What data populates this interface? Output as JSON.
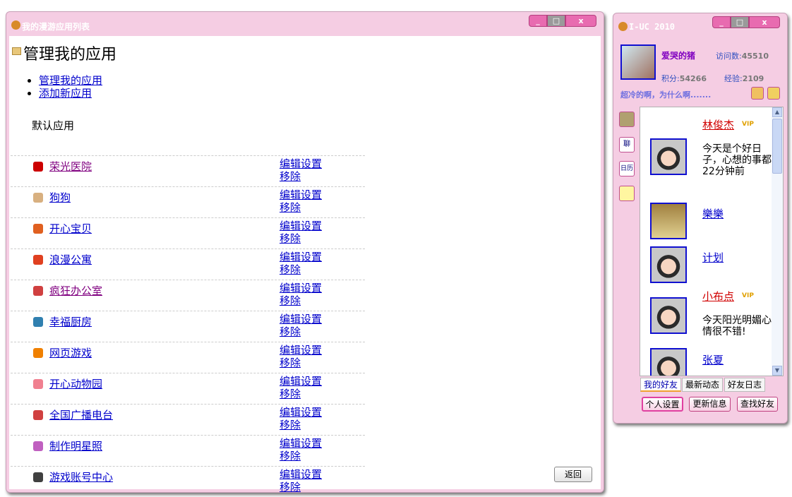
{
  "main_window": {
    "title": "我的漫游应用列表",
    "heading": "管理我的应用",
    "nav": [
      "管理我的应用",
      "添加新应用"
    ],
    "section": "默认应用",
    "apps": [
      {
        "name": "荣光医院",
        "icon": "red-cross-icon",
        "color": "#cc0000",
        "visited": true
      },
      {
        "name": "狗狗",
        "icon": "dog-icon",
        "color": "#d8b080",
        "visited": false
      },
      {
        "name": "开心宝贝",
        "icon": "baby-icon",
        "color": "#e06020",
        "visited": false
      },
      {
        "name": "浪漫公寓",
        "icon": "house-icon",
        "color": "#e04020",
        "visited": false
      },
      {
        "name": "疯狂办公室",
        "icon": "office-icon",
        "color": "#d04040",
        "visited": true
      },
      {
        "name": "幸福厨房",
        "icon": "kitchen-icon",
        "color": "#3080b0",
        "visited": false
      },
      {
        "name": "网页游戏",
        "icon": "game-icon",
        "color": "#f08000",
        "visited": false
      },
      {
        "name": "开心动物园",
        "icon": "pig-icon",
        "color": "#f08090",
        "visited": false
      },
      {
        "name": "全国广播电台",
        "icon": "radio-icon",
        "color": "#d04040",
        "visited": false
      },
      {
        "name": "制作明星照",
        "icon": "star-photo-icon",
        "color": "#c060c0",
        "visited": false
      },
      {
        "name": "游戏账号中心",
        "icon": "account-icon",
        "color": "#404040",
        "visited": false
      }
    ],
    "edit_label": "编辑设置",
    "remove_label": "移除",
    "back_label": "返回"
  },
  "side_window": {
    "title": "I-UC 2010",
    "username": "爱哭的猪",
    "visits_label": "访问数:",
    "visits": "45510",
    "points_label": "积分:",
    "points": "54266",
    "exp_label": "经验:",
    "exp": "2109",
    "status": "超冷的啊，为什么啊.......",
    "side_icons": [
      "photo-icon",
      "chat-icon",
      "calendar-icon",
      "weather-icon"
    ],
    "chat_label": "聊",
    "calendar_label": "日历",
    "friends": [
      {
        "name": "林俊杰",
        "vip": "VIP",
        "text": "今天是个好日子，心想的事都",
        "time": "22分钟前"
      },
      {
        "name": "樂樂"
      },
      {
        "name": "计划"
      },
      {
        "name": "小布点",
        "vip": "VIP",
        "text": "今天阳光明媚心情很不错!"
      },
      {
        "name": "张夏"
      }
    ],
    "tabs": [
      "我的好友",
      "最新动态",
      "好友日志"
    ],
    "buttons": [
      "个人设置",
      "更新信息",
      "查找好友"
    ]
  }
}
